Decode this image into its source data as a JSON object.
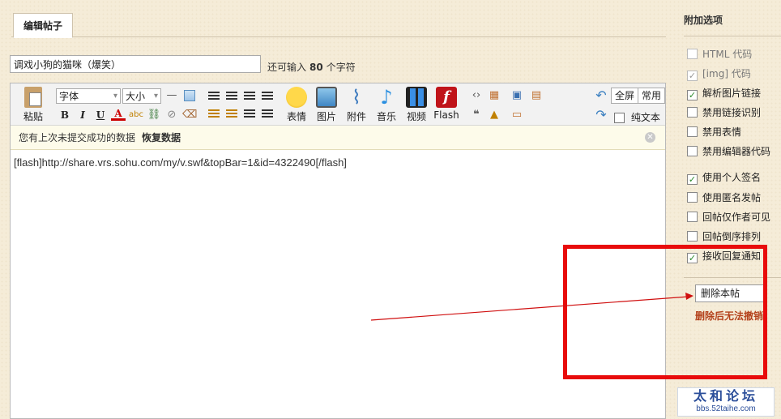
{
  "tab": {
    "label": "编辑帖子"
  },
  "subject": {
    "value": "调戏小狗的猫咪（爆笑）"
  },
  "remain": {
    "prefix": "还可输入",
    "count": "80",
    "suffix": "个字符"
  },
  "toolbar": {
    "paste": "粘贴",
    "font": "字体",
    "size": "大小",
    "bold": "B",
    "italic": "I",
    "underline": "U",
    "color": "A",
    "emoticon": "表情",
    "image": "图片",
    "attach": "附件",
    "music": "音乐",
    "video": "视频",
    "flash": "Flash",
    "fullscreen": "全屏",
    "common": "常用",
    "plaintext": "纯文本"
  },
  "notice": {
    "text": "您有上次未提交成功的数据",
    "action": "恢复数据"
  },
  "editor": {
    "content": "[flash]http://share.vrs.sohu.com/my/v.swf&topBar=1&id=4322490[/flash]"
  },
  "side": {
    "title": "附加选项",
    "options": [
      {
        "label": "HTML 代码",
        "checked": false,
        "disabled": true
      },
      {
        "label": "[img] 代码",
        "checked": true,
        "disabled": true
      },
      {
        "label": "解析图片链接",
        "checked": true,
        "disabled": false
      },
      {
        "label": "禁用链接识别",
        "checked": false,
        "disabled": false
      },
      {
        "label": "禁用表情",
        "checked": false,
        "disabled": false
      },
      {
        "label": "禁用编辑器代码",
        "checked": false,
        "disabled": false
      },
      {
        "label": "使用个人签名",
        "checked": true,
        "disabled": false
      },
      {
        "label": "使用匿名发帖",
        "checked": false,
        "disabled": false
      },
      {
        "label": "回帖仅作者可见",
        "checked": false,
        "disabled": false
      },
      {
        "label": "回帖倒序排列",
        "checked": false,
        "disabled": false
      },
      {
        "label": "接收回复通知",
        "checked": true,
        "disabled": false
      }
    ],
    "delete_label": "删除本帖",
    "delete_warning": "删除后无法撤销"
  },
  "watermark": {
    "title": "太和论坛",
    "url": "bbs.52taihe.com"
  },
  "colors": {
    "annotation": "#e80b0b",
    "warning": "#b4421c",
    "background": "#f5ecd8"
  }
}
